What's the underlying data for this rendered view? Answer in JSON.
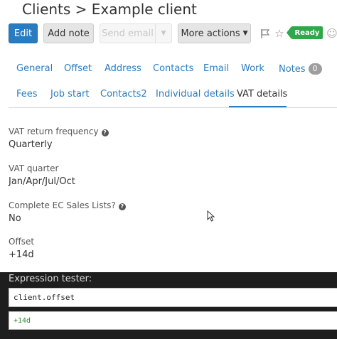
{
  "header": {
    "title": "Clients > Example client"
  },
  "toolbar": {
    "edit_label": "Edit",
    "add_note_label": "Add note",
    "send_email_label": "Send email",
    "more_actions_label": "More actions",
    "status_label": "Ready"
  },
  "icons": {
    "flag": "flag-icon",
    "star": "star-icon",
    "smiley": "smiley-icon",
    "help": "help-icon",
    "caret": "chevron-down-icon"
  },
  "tabs_row1": [
    {
      "label": "General"
    },
    {
      "label": "Offset"
    },
    {
      "label": "Address"
    },
    {
      "label": "Contacts"
    },
    {
      "label": "Email"
    },
    {
      "label": "Work"
    },
    {
      "label": "Notes",
      "badge": "0"
    }
  ],
  "tabs_row2": [
    {
      "label": "Fees"
    },
    {
      "label": "Job start"
    },
    {
      "label": "Contacts2"
    },
    {
      "label": "Individual details"
    },
    {
      "label": "VAT details",
      "active": true
    }
  ],
  "fields": [
    {
      "label": "VAT return frequency",
      "value": "Quarterly",
      "help": true
    },
    {
      "label": "VAT quarter",
      "value": "Jan/Apr/Jul/Oct",
      "help": false
    },
    {
      "label": "Complete EC Sales Lists?",
      "value": "No",
      "help": true
    },
    {
      "label": "Offset",
      "value": "+14d",
      "help": false
    }
  ],
  "tester": {
    "title": "Expression tester:",
    "expression": "client.offset",
    "result": "+14d"
  },
  "colors": {
    "primary": "#2a7cc0",
    "ready": "#2ea84a",
    "badge": "#9e9e9e",
    "tester_bg": "#1e1e1e",
    "result_text": "#2e8b2e"
  }
}
